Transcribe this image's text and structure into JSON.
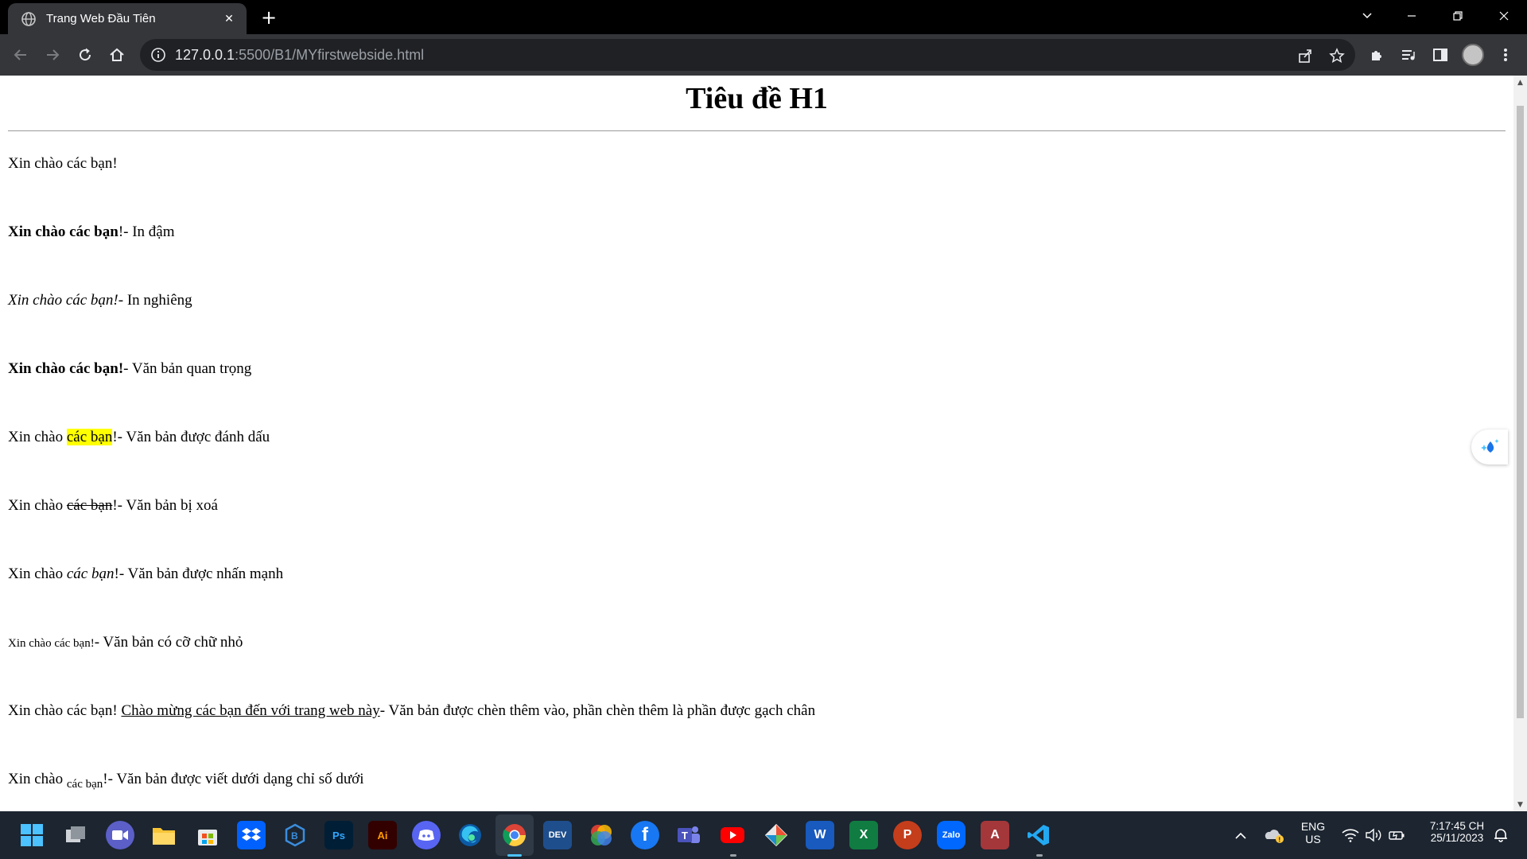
{
  "browser": {
    "tab_title": "Trang Web Đầu Tiên",
    "url_host": "127.0.0.1",
    "url_rest": ":5500/B1/MYfirstwebside.html"
  },
  "page": {
    "heading": "Tiêu đề H1",
    "lines": {
      "l1": "Xin chào các bạn!",
      "l2_bold": "Xin chào các bạn",
      "l2_rest": "!- In đậm",
      "l3_italic": "Xin chào các bạn!",
      "l3_rest": "- In nghiêng",
      "l4_strong": "Xin chào các bạn!",
      "l4_rest": "- Văn bản quan trọng",
      "l5_pre": "Xin chào ",
      "l5_mark": "các bạn",
      "l5_rest": "!- Văn bản được đánh dấu",
      "l6_pre": "Xin chào ",
      "l6_del": "các bạn",
      "l6_rest": "!- Văn bản bị xoá",
      "l7_pre": "Xin chào ",
      "l7_em": "các bạn",
      "l7_rest": "!- Văn bản được nhấn mạnh",
      "l8_small": "Xin chào các bạn!",
      "l8_rest": "- Văn bản có cỡ chữ nhỏ",
      "l9_pre": "Xin chào các bạn! ",
      "l9_ins": "Chào mừng các bạn đến với trang web này",
      "l9_rest": "- Văn bản được chèn thêm vào, phần chèn thêm là phần được gạch chân",
      "l10_pre": "Xin chào ",
      "l10_sub": "các bạn",
      "l10_rest": "!- Văn bản được viết dưới dạng chỉ số dưới"
    }
  },
  "taskbar": {
    "icons": [
      "windows-start",
      "task-view",
      "meet",
      "file-explorer",
      "microsoft-store",
      "dropbox",
      "virtualbox",
      "photoshop",
      "illustrator",
      "discord",
      "edge",
      "chrome",
      "devc",
      "color-app",
      "facebook",
      "teams",
      "youtube",
      "git",
      "word",
      "excel",
      "powerpoint",
      "zalo",
      "access",
      "vscode"
    ],
    "labels": {
      "photoshop": "Ps",
      "illustrator": "Ai",
      "devc": "DEV",
      "word": "W",
      "excel": "X",
      "powerpoint": "P",
      "zalo": "Zalo",
      "access": "A"
    },
    "tray": {
      "lang": "ENG",
      "region": "US",
      "time": "7:17:45 CH",
      "date": "25/11/2023"
    }
  },
  "colors": {
    "titlebar": "#000000",
    "toolbar": "#35363a",
    "omnibox": "#202124",
    "taskbar": "#1c2530",
    "highlight": "#ffff00",
    "accent": "#4cc2ff"
  }
}
